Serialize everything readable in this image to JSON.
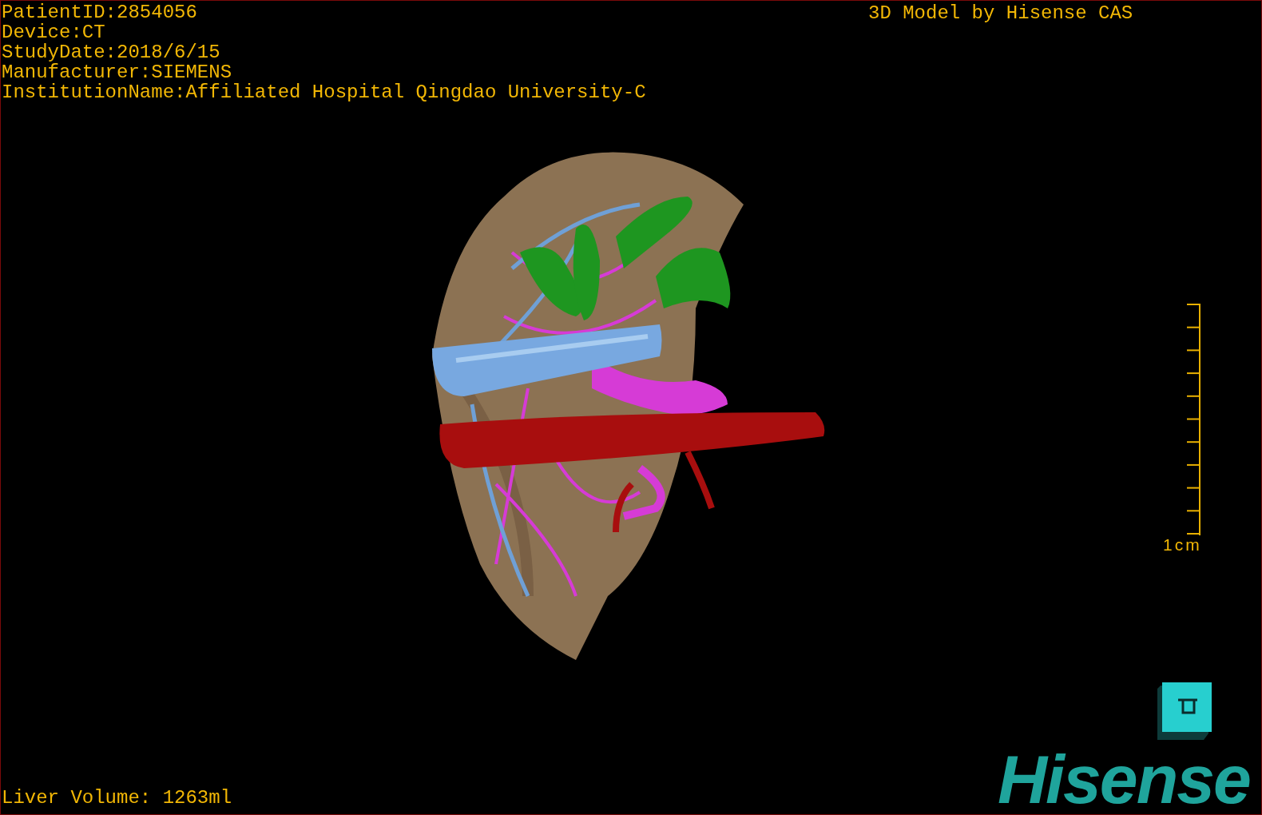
{
  "study_info": [
    "PatientID:2854056",
    "Device:CT",
    "StudyDate:2018/6/15",
    "Manufacturer:SIEMENS",
    "InstitutionName:Affiliated Hospital Qingdao University-C"
  ],
  "model_credit": "3D Model by Hisense CAS",
  "scale_bar": {
    "label": "1cm"
  },
  "liver_volume": "Liver Volume: 1263ml",
  "logo": {
    "text": "Hisense"
  }
}
